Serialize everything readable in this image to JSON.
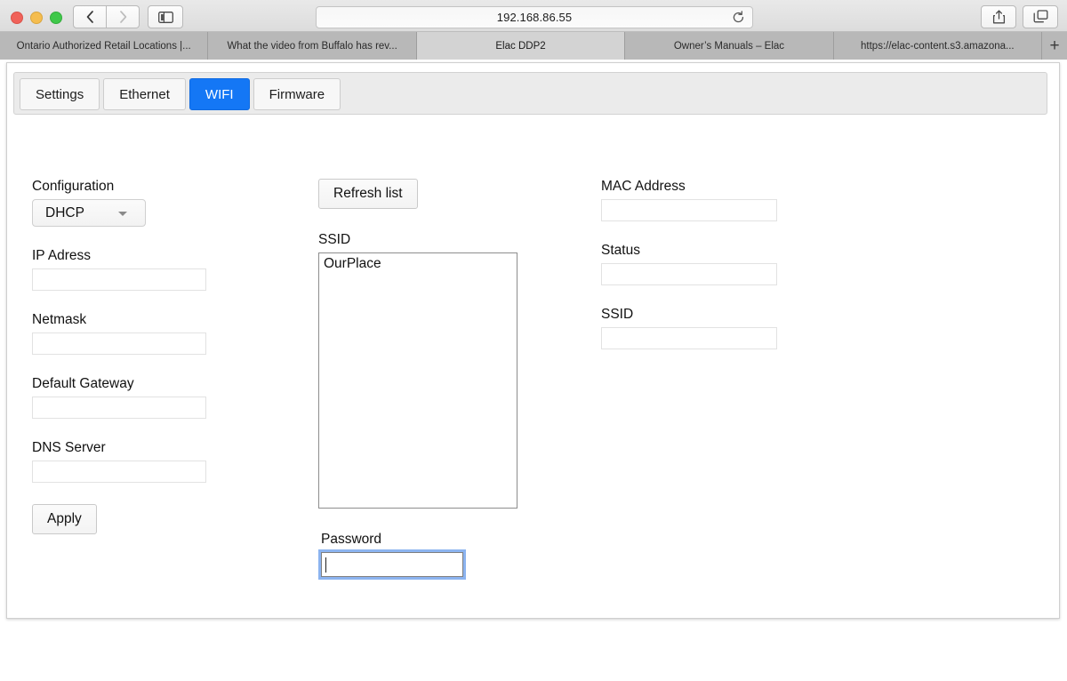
{
  "browser": {
    "window_controls": [
      "close",
      "minimize",
      "maximize"
    ],
    "back_label": "back-icon",
    "forward_label": "forward-icon",
    "sidebar_label": "sidebar-icon",
    "url": "192.168.86.55",
    "reload_label": "reload-icon",
    "share_label": "share-icon",
    "tab_overview_label": "tab-overview-icon",
    "new_tab_label": "+",
    "tabs": [
      {
        "title": "Ontario Authorized Retail Locations |...",
        "active": false
      },
      {
        "title": "What the video from Buffalo has rev...",
        "active": false
      },
      {
        "title": "Elac DDP2",
        "active": true
      },
      {
        "title": "Owner’s Manuals – Elac",
        "active": false
      },
      {
        "title": "https://elac-content.s3.amazona...",
        "active": false
      }
    ]
  },
  "page": {
    "nav_tabs": [
      {
        "label": "Settings",
        "active": false
      },
      {
        "label": "Ethernet",
        "active": false
      },
      {
        "label": "WIFI",
        "active": true
      },
      {
        "label": "Firmware",
        "active": false
      }
    ],
    "accent_color": "#1477f5",
    "left_column": {
      "configuration_label": "Configuration",
      "configuration_value": "DHCP",
      "configuration_options": [
        "DHCP"
      ],
      "ip_address_label": "IP Adress",
      "ip_address_value": "",
      "netmask_label": "Netmask",
      "netmask_value": "",
      "default_gateway_label": "Default Gateway",
      "default_gateway_value": "",
      "dns_server_label": "DNS Server",
      "dns_server_value": "",
      "apply_label": "Apply"
    },
    "middle_column": {
      "refresh_label": "Refresh list",
      "ssid_list_label": "SSID",
      "ssid_list_items": [
        "OurPlace"
      ],
      "password_label": "Password",
      "password_value": "",
      "password_focused": true
    },
    "right_column": {
      "mac_address_label": "MAC Address",
      "mac_address_value": "",
      "status_label": "Status",
      "status_value": "",
      "ssid_label": "SSID",
      "ssid_value": ""
    }
  }
}
